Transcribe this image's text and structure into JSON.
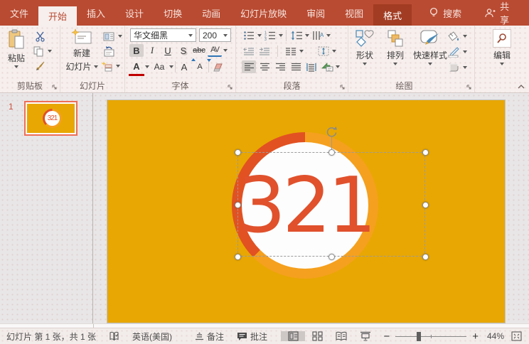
{
  "menu": {
    "tabs": [
      "文件",
      "开始",
      "插入",
      "设计",
      "切换",
      "动画",
      "幻灯片放映",
      "审阅",
      "视图",
      "格式"
    ],
    "search": "搜索",
    "share": "共享"
  },
  "ribbon": {
    "clipboard": {
      "group_label": "剪贴板",
      "paste": "粘贴"
    },
    "slides": {
      "group_label": "幻灯片",
      "new_slide_line1": "新建",
      "new_slide_line2": "幻灯片"
    },
    "font": {
      "group_label": "字体",
      "name": "华文细黑",
      "size": "200",
      "bold": "B",
      "italic": "I",
      "underline": "U",
      "shadow": "S",
      "strike": "abc",
      "spacing": "AV",
      "color_letter": "A",
      "case_label": "Aa",
      "grow": "A",
      "shrink": "A"
    },
    "paragraph": {
      "group_label": "段落"
    },
    "drawing": {
      "group_label": "绘图",
      "shapes": "形状",
      "arrange": "排列",
      "quick_styles": "快速样式"
    },
    "editing": {
      "label": "编辑"
    }
  },
  "slides_panel": {
    "slide_number": "1",
    "thumb_text": "321"
  },
  "slide": {
    "text": "321"
  },
  "status": {
    "slide_info": "幻灯片 第 1 张，共 1 张",
    "language": "英语(美国)",
    "notes": "备注",
    "comments": "批注",
    "zoom_level": "44%"
  },
  "colors": {
    "titlebar": "#B94B32",
    "contextual_tab_bg": "#A23C22",
    "slide_bg": "#E8A702",
    "ring_orange": "#F5A01E",
    "ring_red": "#E25122",
    "countdown_text": "#E0512C",
    "thumbnail_border": "#EE6E55"
  }
}
